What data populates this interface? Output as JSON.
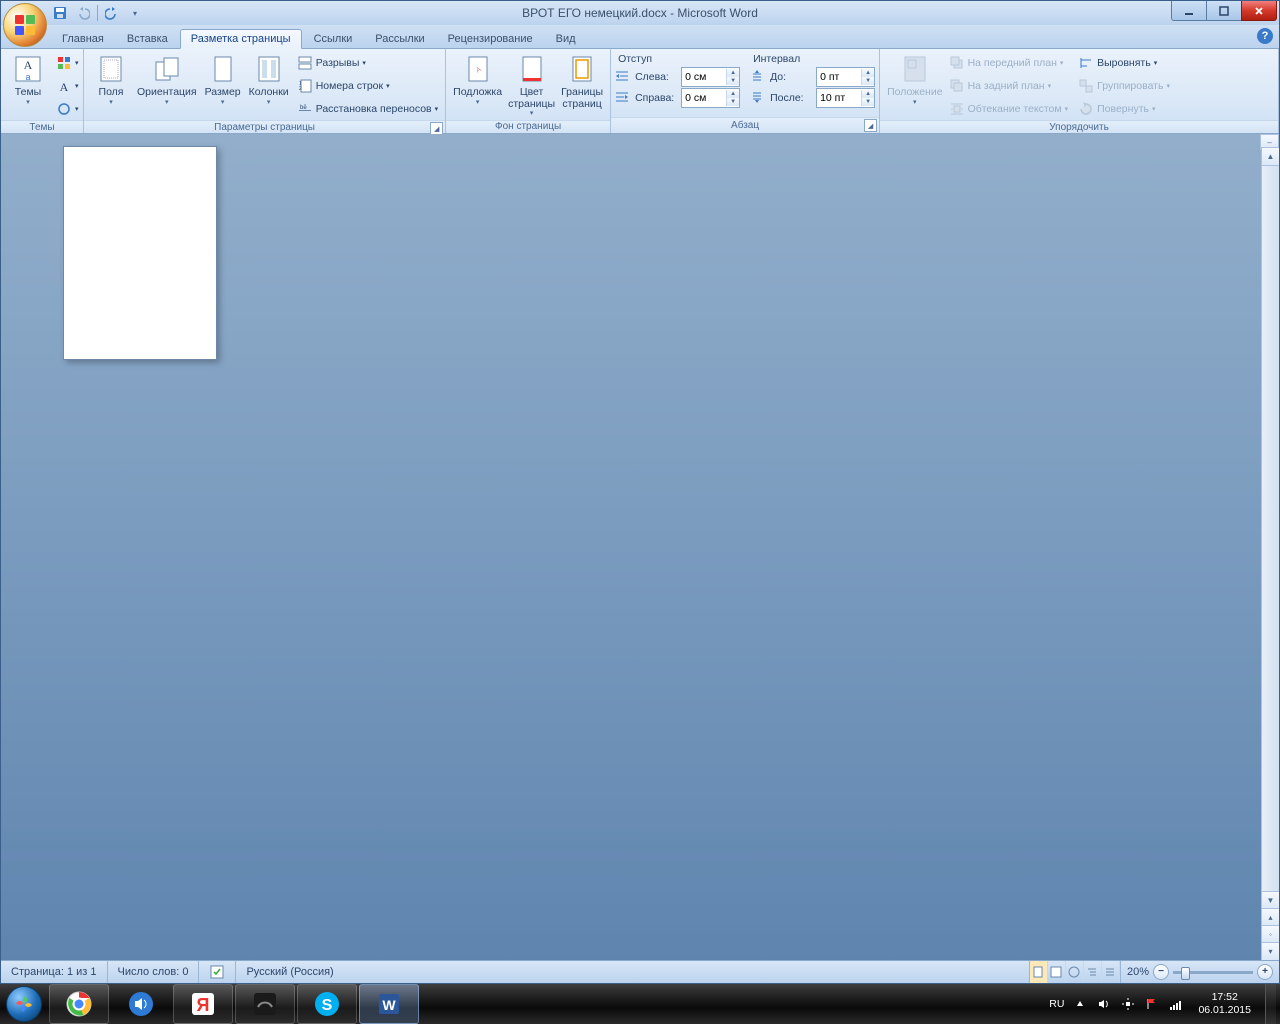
{
  "window": {
    "title": "ВРОТ ЕГО немецкий.docx - Microsoft Word"
  },
  "tabs": {
    "home": "Главная",
    "insert": "Вставка",
    "pagelayout": "Разметка страницы",
    "references": "Ссылки",
    "mailings": "Рассылки",
    "review": "Рецензирование",
    "view": "Вид"
  },
  "ribbon": {
    "themes": {
      "label": "Темы",
      "btn": "Темы"
    },
    "pagesetup": {
      "label": "Параметры страницы",
      "margins": "Поля",
      "orientation": "Ориентация",
      "size": "Размер",
      "columns": "Колонки",
      "breaks": "Разрывы",
      "linenum": "Номера строк",
      "hyphen": "Расстановка переносов"
    },
    "pagebg": {
      "label": "Фон страницы",
      "watermark": "Подложка",
      "pagecolor_l1": "Цвет",
      "pagecolor_l2": "страницы",
      "borders_l1": "Границы",
      "borders_l2": "страниц"
    },
    "paragraph": {
      "label": "Абзац",
      "indent": "Отступ",
      "spacing": "Интервал",
      "left_lbl": "Слева:",
      "left_val": "0 см",
      "right_lbl": "Справа:",
      "right_val": "0 см",
      "before_lbl": "До:",
      "before_val": "0 пт",
      "after_lbl": "После:",
      "after_val": "10 пт"
    },
    "arrange": {
      "label": "Упорядочить",
      "position": "Положение",
      "bringfront": "На передний план",
      "sendback": "На задний план",
      "textwrap": "Обтекание текстом",
      "align": "Выровнять",
      "group": "Группировать",
      "rotate": "Повернуть"
    }
  },
  "status": {
    "page": "Страница: 1 из 1",
    "words": "Число слов: 0",
    "lang": "Русский (Россия)",
    "zoom": "20%"
  },
  "tray": {
    "lang": "RU",
    "time": "17:52",
    "date": "06.01.2015"
  }
}
